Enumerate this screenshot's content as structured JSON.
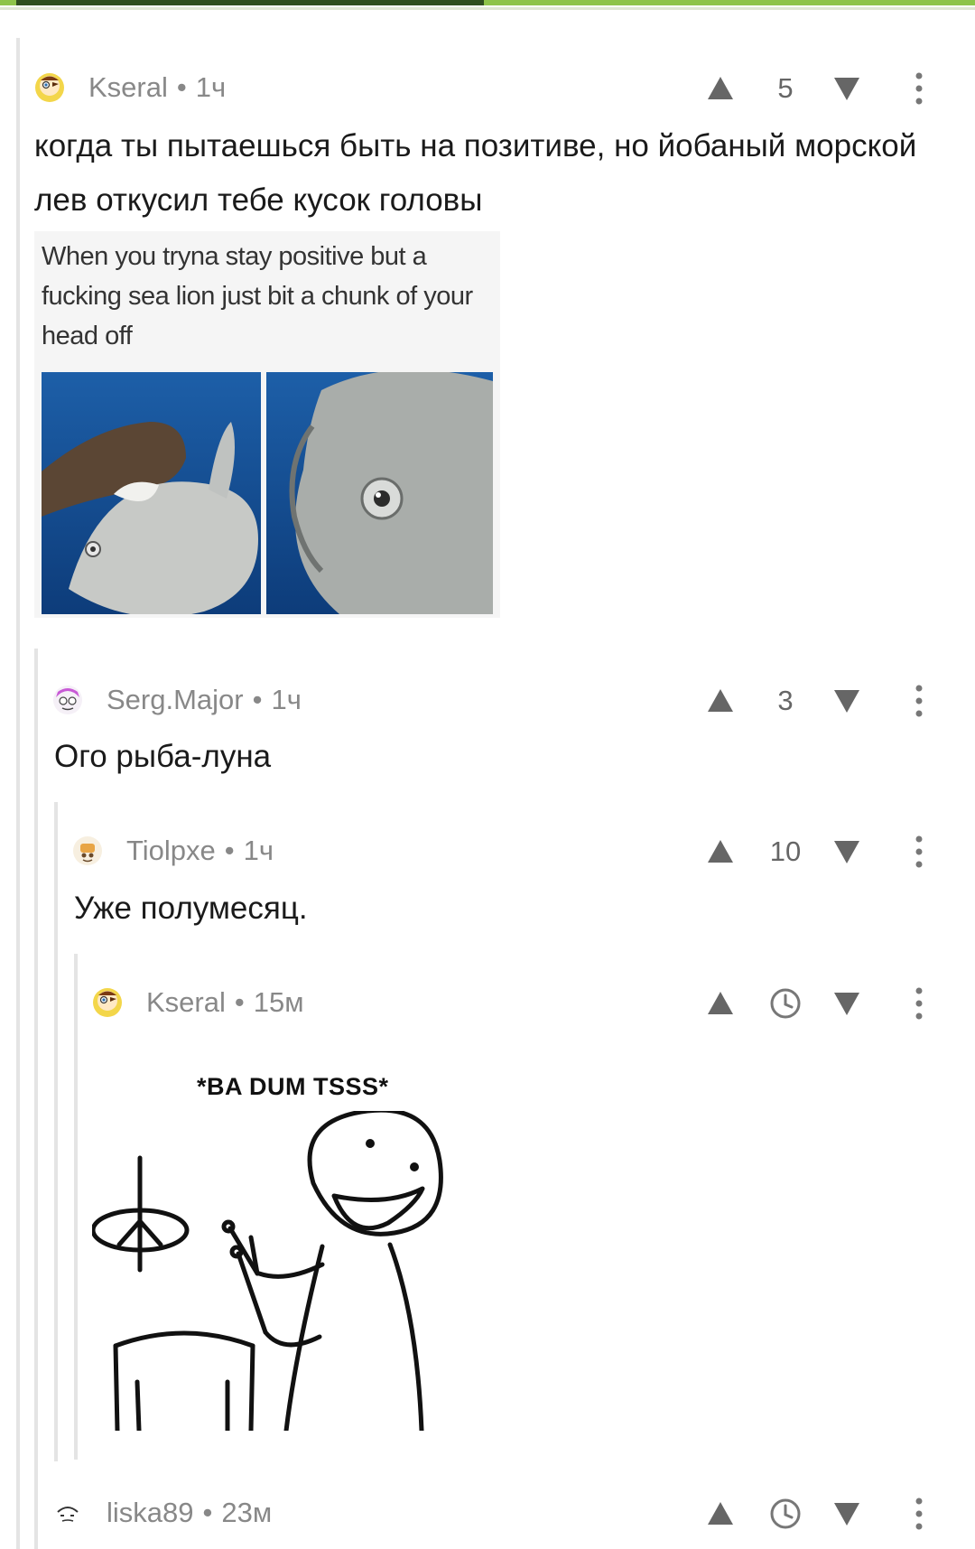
{
  "progress": {
    "value": 0.48
  },
  "comments": [
    {
      "user": "Kseral",
      "time": "1ч",
      "score": "5",
      "text": "когда ты пытаешься быть на позитиве, но йобаный морской лев откусил тебе кусок головы",
      "image": {
        "caption": "When you tryna stay positive but a fucking sea lion just bit a chunk of your head off"
      }
    },
    {
      "user": "Serg.Major",
      "time": "1ч",
      "score": "3",
      "text": "Ого рыба-луна"
    },
    {
      "user": "Tiolpxe",
      "time": "1ч",
      "score": "10",
      "text": "Уже полумесяц."
    },
    {
      "user": "Kseral",
      "time": "15м",
      "score_icon": "clock-icon",
      "image": {
        "caption": "*BA DUM TSSS*"
      }
    },
    {
      "user": "liska89",
      "time": "23м",
      "score_icon": "clock-icon"
    }
  ],
  "colors": {
    "accent": "#8ec44a",
    "accent_dark": "#2f4f1e",
    "meta": "#888888"
  }
}
